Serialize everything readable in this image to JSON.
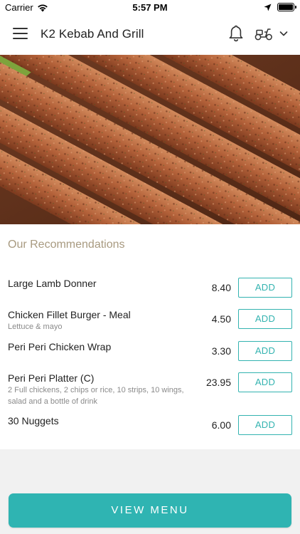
{
  "status_bar": {
    "carrier": "Carrier",
    "time": "5:57 PM"
  },
  "header": {
    "title": "K2 Kebab And Grill",
    "icons": [
      "menu-icon",
      "bell-icon",
      "scooter-icon",
      "chevron-down-icon"
    ]
  },
  "hero": {
    "icon": "kebab-photo"
  },
  "recommendations": {
    "title": "Our Recommendations",
    "items": [
      {
        "name": "Large Lamb Donner",
        "description": "",
        "price": "8.40",
        "add_label": "ADD"
      },
      {
        "name": "Chicken Fillet Burger - Meal",
        "description": "Lettuce & mayo",
        "price": "4.50",
        "add_label": "ADD"
      },
      {
        "name": "Peri Peri Chicken Wrap",
        "description": "",
        "price": "3.30",
        "add_label": "ADD"
      },
      {
        "name": "Peri Peri Platter (C)",
        "description": "2 Full chickens, 2 chips or rice, 10 strips, 10 wings, salad and a bottle of drink",
        "price": "23.95",
        "add_label": "ADD"
      },
      {
        "name": "30 Nuggets",
        "description": "",
        "price": "6.00",
        "add_label": "ADD"
      }
    ]
  },
  "footer": {
    "view_menu_label": "VIEW MENU"
  },
  "colors": {
    "accent": "#2fb4b2",
    "section_title": "#a89a80",
    "background_gray": "#f1f1f1"
  }
}
